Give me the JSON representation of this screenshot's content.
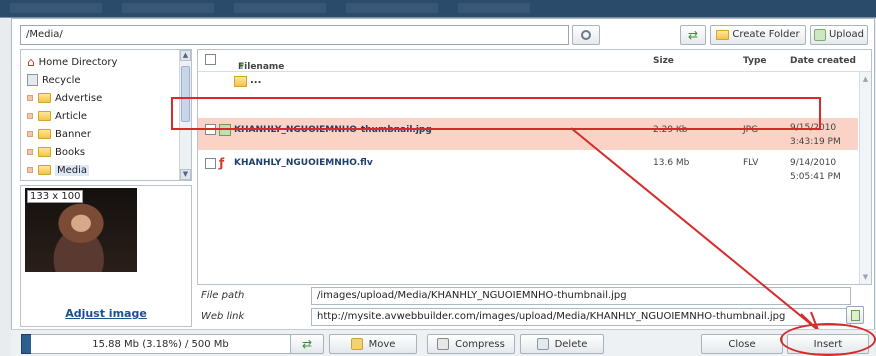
{
  "path": "/Media/",
  "toolbar": {
    "create_folder": "Create Folder",
    "upload": "Upload",
    "search_icon": "search-icon",
    "refresh_icon": "refresh-icon"
  },
  "tree": [
    {
      "label": "Home Directory",
      "icon": "home-icon"
    },
    {
      "label": "Recycle",
      "icon": "recycle-icon"
    },
    {
      "label": "Advertise",
      "icon": "folder-icon"
    },
    {
      "label": "Article",
      "icon": "folder-icon"
    },
    {
      "label": "Banner",
      "icon": "folder-icon"
    },
    {
      "label": "Books",
      "icon": "folder-icon"
    },
    {
      "label": "Media",
      "icon": "folder-icon",
      "selected": true
    }
  ],
  "preview": {
    "dimensions": "133 x 100",
    "adjust_label": "Adjust image"
  },
  "columns": {
    "filename": "Filename",
    "size": "Size",
    "type": "Type",
    "date": "Date created"
  },
  "parent_dir": "...",
  "files": [
    {
      "name": "KHANHLY_NGUOIEMNHO-thumbnail.jpg",
      "size": "2.29 Kb",
      "type": "JPG",
      "date": "9/15/2010",
      "time": "3:43:19 PM",
      "icon": "image-file-icon"
    },
    {
      "name": "KHANHLY_NGUOIEMNHO.flv",
      "size": "13.6 Mb",
      "type": "FLV",
      "date": "9/14/2010",
      "time": "5:05:41 PM",
      "icon": "flash-file-icon"
    }
  ],
  "fields": {
    "file_path_label": "File path",
    "file_path": "/images/upload/Media/KHANHLY_NGUOIEMNHO-thumbnail.jpg",
    "web_link_label": "Web link",
    "web_link": "http://mysite.avwebbuilder.com/images/upload/Media/KHANHLY_NGUOIEMNHO-thumbnail.jpg"
  },
  "bottom": {
    "quota": "15.88 Mb (3.18%) / 500 Mb",
    "quota_fraction": 0.0318,
    "move": "Move",
    "compress": "Compress",
    "delete": "Delete",
    "close": "Close",
    "insert": "Insert"
  },
  "colors": {
    "selection": "#fbd2c6",
    "annotation_red": "#d62b2b",
    "link_blue": "#1d4f8f"
  }
}
